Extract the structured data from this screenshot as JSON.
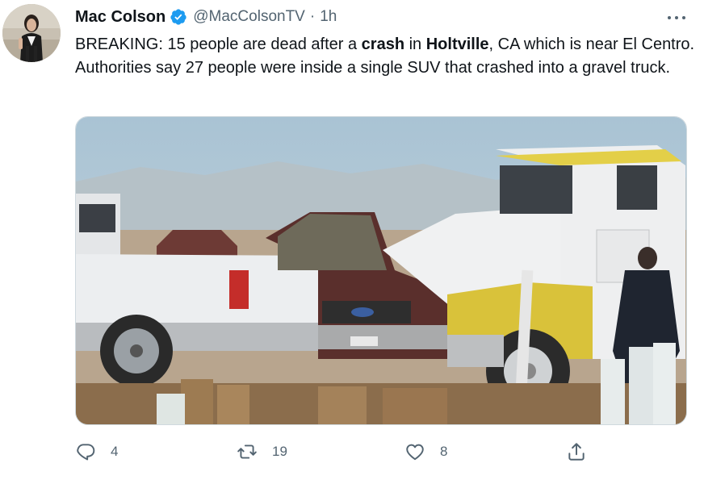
{
  "tweet": {
    "author": {
      "name": "Mac Colson",
      "handle": "@MacColsonTV",
      "separator": "·",
      "time": "1h",
      "verified": true
    },
    "text": {
      "part1": "BREAKING: 15 people are dead after a ",
      "bold1": "crash",
      "part2": " in ",
      "bold2": "Holtville",
      "part3": ", CA which is near El Centro. Authorities say 27 people were inside a single SUV that crashed into a gravel truck."
    },
    "actions": {
      "replies": "4",
      "retweets": "19",
      "likes": "8"
    },
    "icons": {
      "more": "more-options-icon",
      "verified": "verified-badge-icon",
      "reply": "reply-icon",
      "retweet": "retweet-icon",
      "like": "heart-icon",
      "share": "share-icon"
    },
    "colors": {
      "verified": "#1d9bf0",
      "secondary_text": "#536471",
      "primary_text": "#0f1419"
    }
  }
}
